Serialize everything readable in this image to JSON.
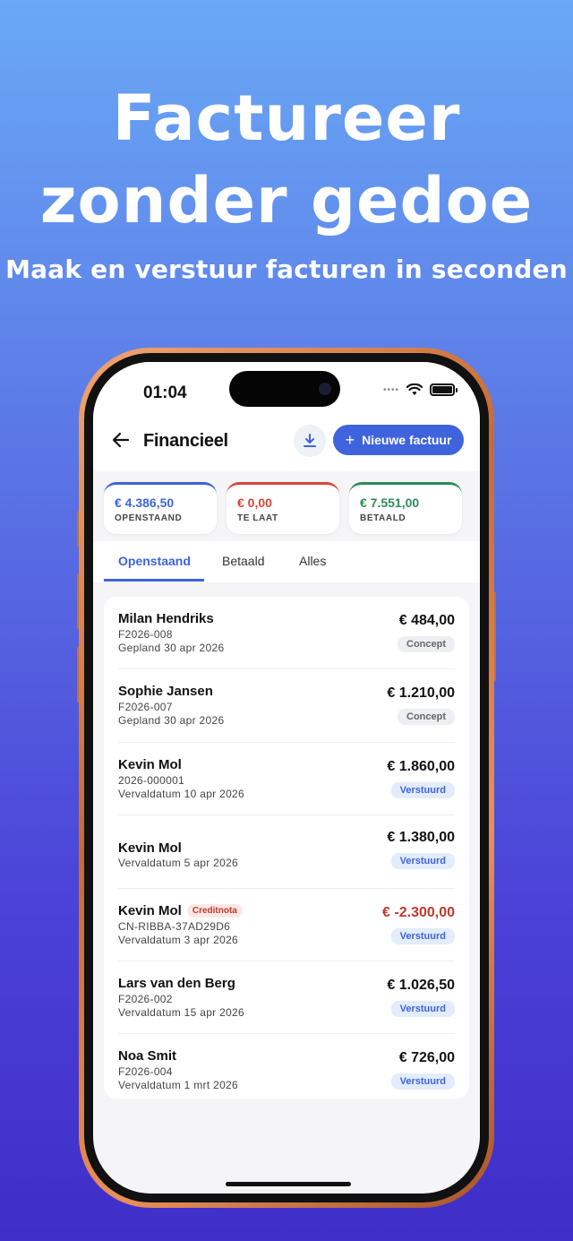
{
  "hero": {
    "title_line1": "Factureer",
    "title_line2": "zonder gedoe",
    "subtitle": "Maak en verstuur facturen in seconden"
  },
  "status_bar": {
    "time": "01:04",
    "signal": "••••"
  },
  "header": {
    "title": "Financieel",
    "new_invoice_label": "Nieuwe factuur",
    "icons": {
      "back": "back-arrow-icon",
      "download": "download-icon",
      "plus": "plus-icon"
    }
  },
  "summary": [
    {
      "amount": "€ 4.386,50",
      "label": "OPENSTAAND",
      "color": "#3e63dd"
    },
    {
      "amount": "€ 0,00",
      "label": "TE LAAT",
      "color": "#d9453a"
    },
    {
      "amount": "€ 7.551,00",
      "label": "BETAALD",
      "color": "#2e8b57"
    }
  ],
  "tabs": [
    {
      "label": "Openstaand",
      "active": true
    },
    {
      "label": "Betaald",
      "active": false
    },
    {
      "label": "Alles",
      "active": false
    }
  ],
  "invoices": [
    {
      "name": "Milan Hendriks",
      "number": "F2026-008",
      "date": "Gepland 30 apr 2026",
      "amount": "€ 484,00",
      "status": "Concept"
    },
    {
      "name": "Sophie Jansen",
      "number": "F2026-007",
      "date": "Gepland 30 apr 2026",
      "amount": "€ 1.210,00",
      "status": "Concept"
    },
    {
      "name": "Kevin Mol",
      "number": "2026-000001",
      "date": "Vervaldatum 10 apr 2026",
      "amount": "€ 1.860,00",
      "status": "Verstuurd"
    },
    {
      "name": "Kevin Mol",
      "number": "",
      "date": "Vervaldatum 5 apr 2026",
      "amount": "€ 1.380,00",
      "status": "Verstuurd"
    },
    {
      "name": "Kevin Mol",
      "badge": "Creditnota",
      "number": "CN-RIBBA-37AD29D6",
      "date": "Vervaldatum 3 apr 2026",
      "amount": "€ -2.300,00",
      "status": "Verstuurd"
    },
    {
      "name": "Lars van den Berg",
      "number": "F2026-002",
      "date": "Vervaldatum 15 apr 2026",
      "amount": "€ 1.026,50",
      "status": "Verstuurd"
    },
    {
      "name": "Noa Smit",
      "number": "F2026-004",
      "date": "Vervaldatum 1 mrt 2026",
      "amount": "€ 726,00",
      "status": "Verstuurd"
    }
  ]
}
